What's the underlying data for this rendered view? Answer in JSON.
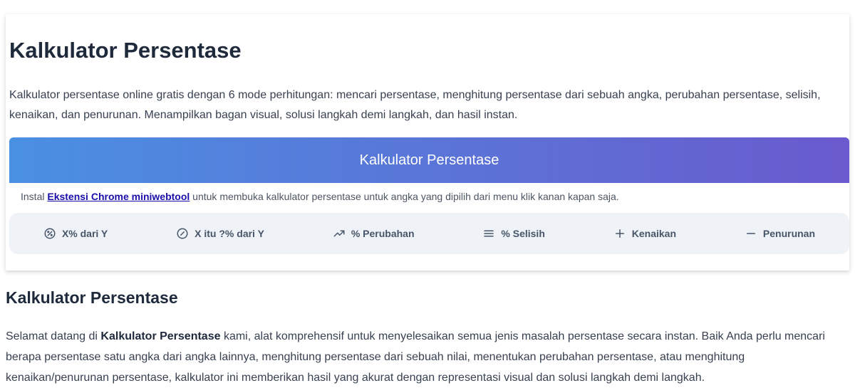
{
  "header": {
    "title": "Kalkulator Persentase",
    "description": "Kalkulator persentase online gratis dengan 6 mode perhitungan: mencari persentase, menghitung persentase dari sebuah angka, perubahan persentase, selisih, kenaikan, dan penurunan. Menampilkan bagan visual, solusi langkah demi langkah, dan hasil instan."
  },
  "banner": {
    "title": "Kalkulator Persentase"
  },
  "install_note": {
    "prefix": "Instal ",
    "link_text": "Ekstensi Chrome miniwebtool",
    "suffix": " untuk membuka kalkulator persentase untuk angka yang dipilih dari menu klik kanan kapan saja."
  },
  "tabs": [
    {
      "label": "X% dari Y",
      "icon": "percent-circle-icon"
    },
    {
      "label": "X itu ?% dari Y",
      "icon": "compass-icon"
    },
    {
      "label": "% Perubahan",
      "icon": "trending-up-icon"
    },
    {
      "label": "% Selisih",
      "icon": "menu-lines-icon"
    },
    {
      "label": "Kenaikan",
      "icon": "plus-icon"
    },
    {
      "label": "Penurunan",
      "icon": "minus-icon"
    }
  ],
  "section": {
    "title": "Kalkulator Persentase",
    "text_prefix": "Selamat datang di ",
    "text_bold": "Kalkulator Persentase",
    "text_suffix": " kami, alat komprehensif untuk menyelesaikan semua jenis masalah persentase secara instan. Baik Anda perlu mencari berapa persentase satu angka dari angka lainnya, menghitung persentase dari sebuah nilai, menentukan perubahan persentase, atau menghitung kenaikan/penurunan persentase, kalkulator ini memberikan hasil yang akurat dengan representasi visual dan solusi langkah demi langkah."
  },
  "colors": {
    "banner_start": "#4a90e2",
    "banner_end": "#6a5acd",
    "tabs_background": "#eff3f8",
    "link": "#1a0dab"
  }
}
